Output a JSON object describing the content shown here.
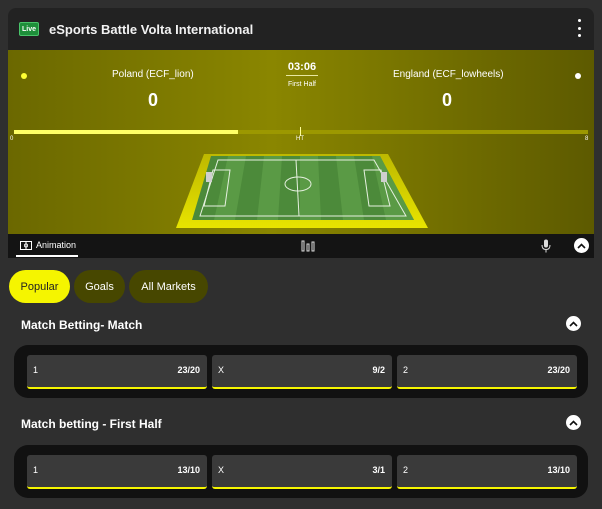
{
  "header": {
    "live_badge": "Live",
    "title": "eSports Battle Volta International",
    "menu_icon": "kebab-menu-icon"
  },
  "scoreboard": {
    "home_name": "Poland (ECF_lion)",
    "home_score": "0",
    "away_name": "England (ECF_lowheels)",
    "away_score": "0",
    "clock": "03:06",
    "period": "First Half",
    "timeline_start": "0",
    "timeline_mid": "HT",
    "timeline_end": "8",
    "progress_fraction": 0.39,
    "home_color": "#ffff33",
    "away_color": "#ffffff"
  },
  "animation_bar": {
    "animation_label": "Animation",
    "animation_icon": "pitch-icon",
    "stats_icon": "bar-chart-icon",
    "mic_icon": "microphone-icon",
    "collapse_icon": "chevron-up-icon"
  },
  "tabs": [
    {
      "label": "Popular",
      "active": true
    },
    {
      "label": "Goals",
      "active": false
    },
    {
      "label": "All Markets",
      "active": false
    }
  ],
  "markets": [
    {
      "title": "Match Betting- Match",
      "outcomes": [
        {
          "label": "1",
          "odds": "23/20"
        },
        {
          "label": "X",
          "odds": "9/2"
        },
        {
          "label": "2",
          "odds": "23/20"
        }
      ]
    },
    {
      "title": "Match betting - First Half",
      "outcomes": [
        {
          "label": "1",
          "odds": "13/10"
        },
        {
          "label": "X",
          "odds": "3/1"
        },
        {
          "label": "2",
          "odds": "13/10"
        }
      ]
    }
  ],
  "colors": {
    "accent": "#f5f500",
    "live_green": "#1e8f3a"
  }
}
